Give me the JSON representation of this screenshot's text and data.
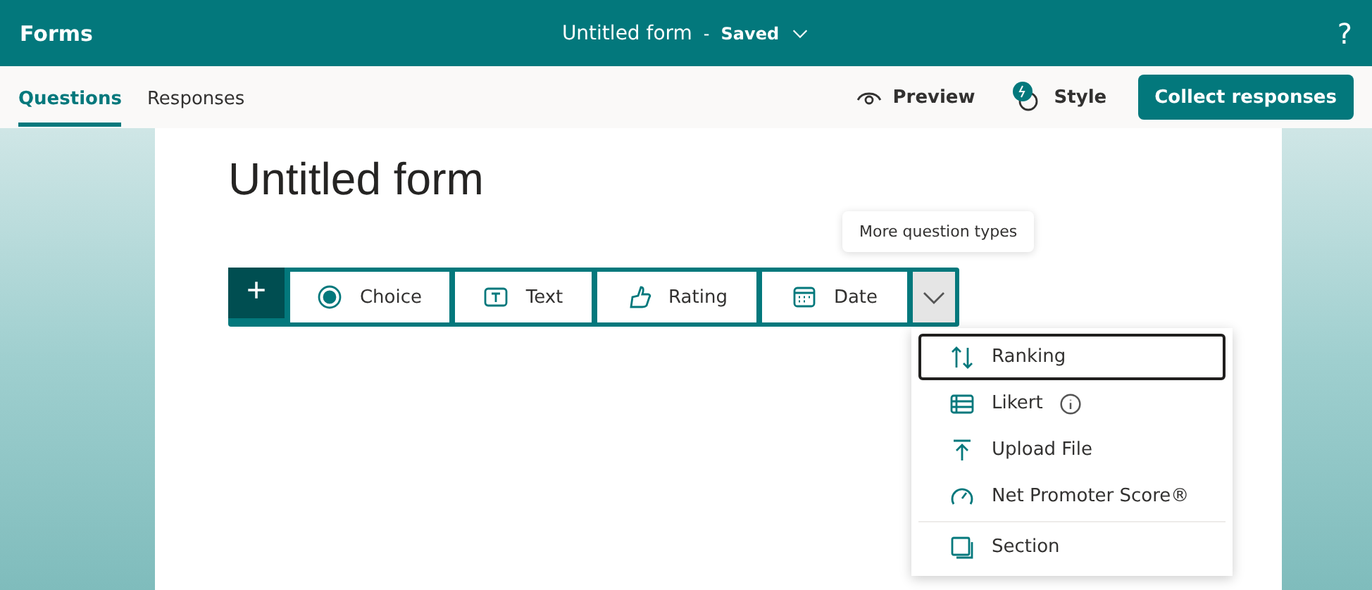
{
  "header": {
    "app": "Forms",
    "title": "Untitled form",
    "separator": "-",
    "status": "Saved",
    "help": "?"
  },
  "tabs": [
    {
      "label": "Questions",
      "selected": true
    },
    {
      "label": "Responses",
      "selected": false
    }
  ],
  "actions": {
    "preview": "Preview",
    "style": "Style",
    "collect": "Collect responses"
  },
  "form": {
    "title": "Untitled form"
  },
  "toolbar": {
    "add": "+",
    "types": [
      "Choice",
      "Text",
      "Rating",
      "Date"
    ]
  },
  "tooltip": "More question types",
  "menu": [
    {
      "label": "Ranking",
      "selected": true
    },
    {
      "label": "Likert",
      "selected": false
    },
    {
      "label": "Upload File",
      "selected": false
    },
    {
      "label": "Net Promoter Score®",
      "selected": false
    },
    {
      "label": "Section",
      "selected": false
    }
  ]
}
